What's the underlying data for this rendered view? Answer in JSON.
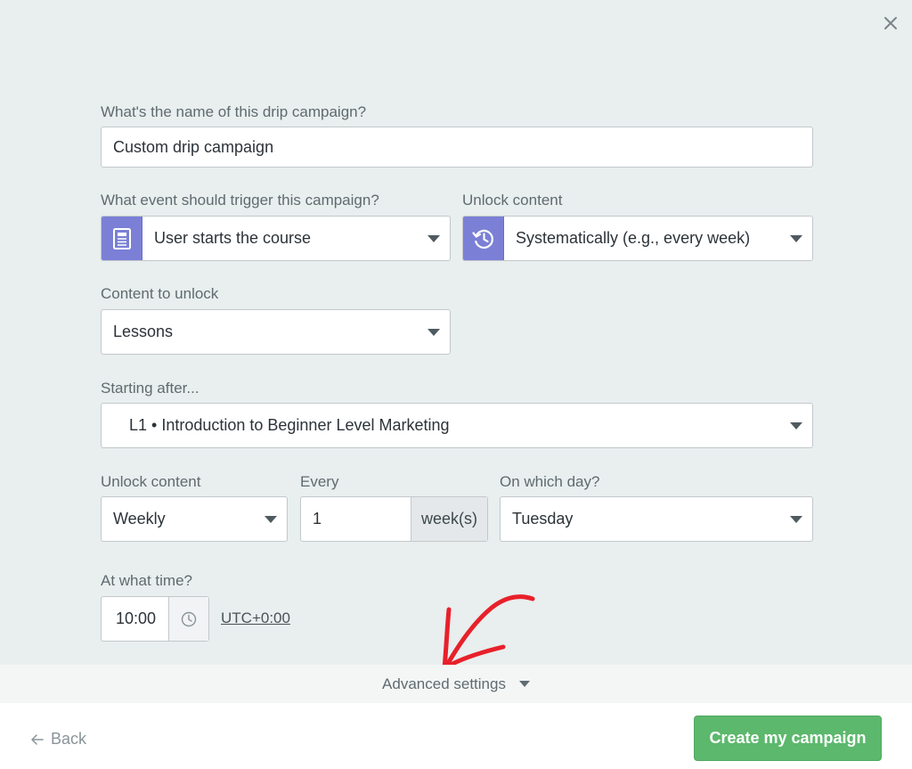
{
  "form": {
    "name_label": "What's the name of this drip campaign?",
    "name_value": "Custom drip campaign",
    "trigger_label": "What event should trigger this campaign?",
    "trigger_value": "User starts the course",
    "unlock_label": "Unlock content",
    "unlock_value": "Systematically (e.g., every week)",
    "content_label": "Content to unlock",
    "content_value": "Lessons",
    "starting_label": "Starting after...",
    "starting_value": "L1 • Introduction to Beginner Level Marketing",
    "frequency_label": "Unlock content",
    "frequency_value": "Weekly",
    "every_label": "Every",
    "every_value": "1",
    "every_unit": "week(s)",
    "day_label": "On which day?",
    "day_value": "Tuesday",
    "time_label": "At what time?",
    "time_value": "10:00",
    "timezone": "UTC+0:00"
  },
  "advanced": {
    "label": "Advanced settings"
  },
  "footer": {
    "back_label": "Back",
    "create_label": "Create my campaign"
  },
  "icons": {
    "close": "close-icon",
    "trigger": "document-icon",
    "unlock": "history-icon",
    "time": "clock-icon",
    "back": "arrow-left-icon"
  },
  "colors": {
    "accent": "#7b80d6",
    "primary_button": "#5cb86d",
    "annotation": "#e8202a"
  }
}
